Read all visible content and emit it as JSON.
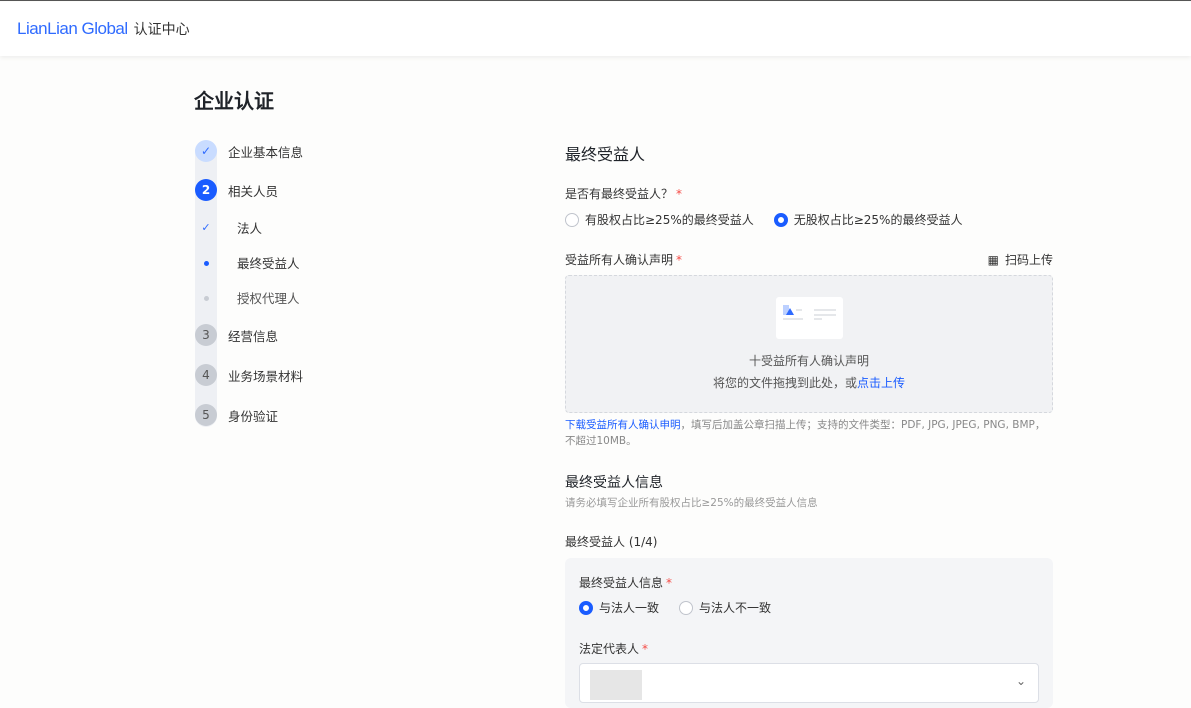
{
  "header": {
    "logo": "LianLian Global",
    "subtitle": "认证中心"
  },
  "page_title": "企业认证",
  "steps": [
    {
      "label": "企业基本信息",
      "status": "done"
    },
    {
      "label": "相关人员",
      "number": "2",
      "status": "active",
      "children": [
        {
          "label": "法人",
          "status": "done"
        },
        {
          "label": "最终受益人",
          "status": "active"
        },
        {
          "label": "授权代理人",
          "status": "todo"
        }
      ]
    },
    {
      "label": "经营信息",
      "number": "3",
      "status": "todo"
    },
    {
      "label": "业务场景材料",
      "number": "4",
      "status": "todo"
    },
    {
      "label": "身份验证",
      "number": "5",
      "status": "todo"
    }
  ],
  "form": {
    "section_title": "最终受益人",
    "has_ubo_label": "是否有最终受益人？",
    "has_ubo_options": [
      "有股权占比≥25%的最终受益人",
      "无股权占比≥25%的最终受益人"
    ],
    "has_ubo_selected": 1,
    "declaration_label": "受益所有人确认声明",
    "scan_upload": "扫码上传",
    "upload_title": "十受益所有人确认声明",
    "upload_drag": "将您的文件拖拽到此处，或",
    "upload_click": "点击上传",
    "download_link": "下载受益所有人确认申明",
    "hint": "，填写后加盖公章扫描上传；支持的文件类型：PDF, JPG, JPEG, PNG, BMP，不超过10MB。",
    "info_title": "最终受益人信息",
    "info_subtitle": "请务必填写企业所有股权占比≥25%的最终受益人信息",
    "ubo_counter": "最终受益人 (1/4)",
    "card": {
      "info_label": "最终受益人信息",
      "options": [
        "与法人一致",
        "与法人不一致"
      ],
      "selected": 0,
      "legal_rep_label": "法定代表人"
    }
  },
  "required_mark": "*"
}
